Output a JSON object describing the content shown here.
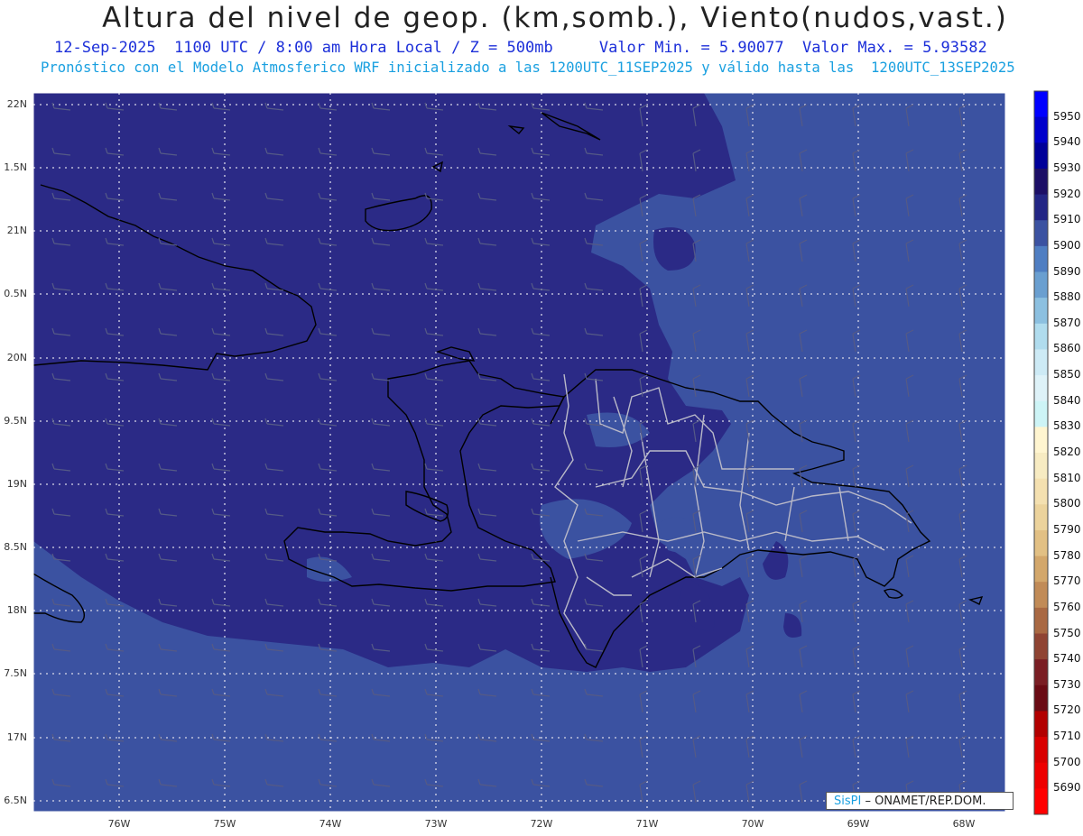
{
  "header": {
    "title": "Altura del nivel de geop. (km,somb.), Viento(nudos,vast.)",
    "subtitle1": "12-Sep-2025  1100 UTC / 8:00 am Hora Local / Z = 500mb     Valor Min. = 5.90077  Valor Max. = 5.93582",
    "subtitle2": "Pronóstico con el Modelo Atmosferico WRF inicializado a las 1200UTC_11SEP2025 y válido hasta las  1200UTC_13SEP2025"
  },
  "map": {
    "lat_labels": [
      "22N",
      "1.5N",
      "21N",
      "0.5N",
      "20N",
      "9.5N",
      "19N",
      "8.5N",
      "18N",
      "7.5N",
      "17N",
      "6.5N"
    ],
    "lon_labels": [
      "76W",
      "75W",
      "74W",
      "73W",
      "72W",
      "71W",
      "70W",
      "69W",
      "68W"
    ],
    "colors": {
      "dark": "#2b2a86",
      "light": "#3b52a1",
      "grid": "#d8d8e8"
    }
  },
  "colorbar": {
    "labels": [
      "5950",
      "5940",
      "5930",
      "5920",
      "5910",
      "5900",
      "5890",
      "5880",
      "5870",
      "5860",
      "5850",
      "5840",
      "5830",
      "5820",
      "5810",
      "5800",
      "5790",
      "5780",
      "5770",
      "5760",
      "5750",
      "5740",
      "5730",
      "5720",
      "5710",
      "5700",
      "5690"
    ],
    "colors": [
      "#0000ff",
      "#0000cc",
      "#000099",
      "#1c0f66",
      "#232685",
      "#3b52a1",
      "#4f7ec2",
      "#6a9fd0",
      "#8cc0e0",
      "#b0dcee",
      "#cdeaf5",
      "#def2f8",
      "#cdf4f6",
      "#fff5d0",
      "#f7ebc2",
      "#f4e0b0",
      "#ecd39c",
      "#e2c084",
      "#d3a76b",
      "#c18b57",
      "#a96943",
      "#8f4433",
      "#7a1e24",
      "#6a0b14",
      "#b20000",
      "#d90000",
      "#ee0000",
      "#ff0000"
    ]
  },
  "credit": {
    "brand": "SisPI",
    "rest": " – ONAMET/REP.DOM."
  }
}
